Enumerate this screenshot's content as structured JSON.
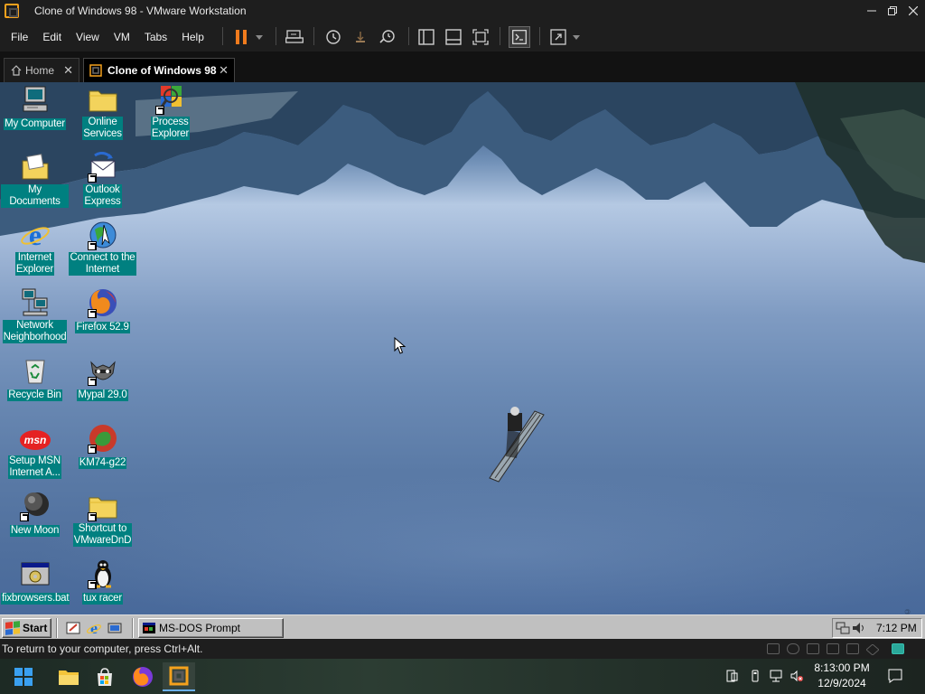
{
  "window": {
    "title": "Clone of Windows 98 - VMware Workstation"
  },
  "menu": [
    "File",
    "Edit",
    "View",
    "VM",
    "Tabs",
    "Help"
  ],
  "tabs": [
    {
      "label": "Home",
      "active": false
    },
    {
      "label": "Clone of Windows 98",
      "active": true
    }
  ],
  "desktop": {
    "icons": [
      {
        "label": "My Computer",
        "icon": "computer-icon"
      },
      {
        "label": "Online\nServices",
        "icon": "folder-icon"
      },
      {
        "label": "Process\nExplorer",
        "icon": "process-explorer-icon"
      },
      {
        "label": "My Documents",
        "icon": "documents-folder-icon"
      },
      {
        "label": "Outlook\nExpress",
        "icon": "outlook-express-icon"
      },
      {
        "label": "Internet\nExplorer",
        "icon": "internet-explorer-icon"
      },
      {
        "label": "Connect to the\nInternet",
        "icon": "connect-internet-icon"
      },
      {
        "label": "Network\nNeighborhood",
        "icon": "network-icon"
      },
      {
        "label": "Firefox 52.9",
        "icon": "firefox-icon"
      },
      {
        "label": "Recycle Bin",
        "icon": "recycle-bin-icon"
      },
      {
        "label": "Mypal 29.0",
        "icon": "mypal-icon"
      },
      {
        "label": "Setup MSN\nInternet A...",
        "icon": "msn-icon"
      },
      {
        "label": "KM74-g22",
        "icon": "km74-icon"
      },
      {
        "label": "New Moon",
        "icon": "new-moon-icon"
      },
      {
        "label": "Shortcut to\nVMwareDnD",
        "icon": "folder-shortcut-icon"
      },
      {
        "label": "fixbrowsers.bat",
        "icon": "batch-file-icon"
      },
      {
        "label": "tux racer",
        "icon": "tux-icon"
      }
    ],
    "msn_logo_text": "msn"
  },
  "guest_taskbar": {
    "start_label": "Start",
    "task_button": "MS-DOS Prompt",
    "clock": "7:12 PM"
  },
  "status_bar": {
    "message": "To return to your computer, press Ctrl+Alt."
  },
  "host_taskbar": {
    "time": "8:13:00 PM",
    "date": "12/9/2024"
  },
  "colors": {
    "desktop_label_bg": "#008080",
    "pause_accent": "#f07b1d",
    "vmware_logo": "#f4a11d"
  }
}
